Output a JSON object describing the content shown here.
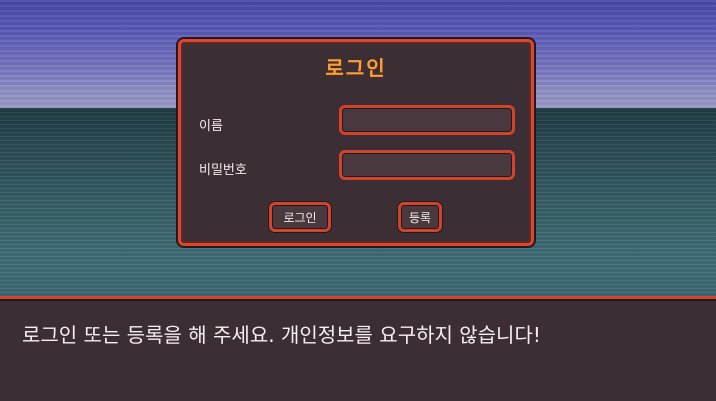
{
  "dialog": {
    "title": "로그인",
    "name_label": "이름",
    "name_value": "",
    "password_label": "비밀번호",
    "password_value": "",
    "login_button": "로그인",
    "register_button": "등록"
  },
  "message": {
    "text": "로그인 또는 등록을 해 주세요. 개인정보를 요구하지 않습니다!"
  },
  "colors": {
    "accent_border": "#e0452e",
    "title": "#f6a13a",
    "panel_bg": "#3b2f35",
    "text": "#f2ecea"
  }
}
